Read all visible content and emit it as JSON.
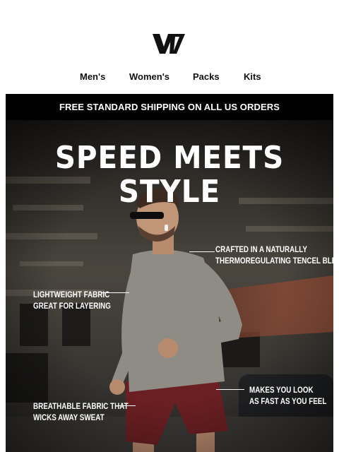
{
  "brand": {
    "logo_icon": "brand-logo-icon"
  },
  "nav": {
    "items": [
      {
        "label": "Men's"
      },
      {
        "label": "Women's"
      },
      {
        "label": "Packs"
      },
      {
        "label": "Kits"
      }
    ]
  },
  "promo": {
    "text": "FREE STANDARD SHIPPING ON ALL US ORDERS"
  },
  "hero": {
    "headline": "SPEED MEETS STYLE",
    "callouts": [
      {
        "line1": "CRAFTED IN A NATURALLY",
        "line2": "THERMOREGULATING TENCEL BLEND"
      },
      {
        "line1": "LIGHTWEIGHT FABRIC",
        "line2": "GREAT FOR LAYERING"
      },
      {
        "line1": "MAKES YOU LOOK",
        "line2": "AS FAST AS YOU FEEL"
      },
      {
        "line1": "BREATHABLE FABRIC THAT",
        "line2": "WICKS AWAY SWEAT"
      }
    ]
  },
  "colors": {
    "shirt": "#8f8c86",
    "shorts": "#6b1f22",
    "background": "#2a2926"
  }
}
